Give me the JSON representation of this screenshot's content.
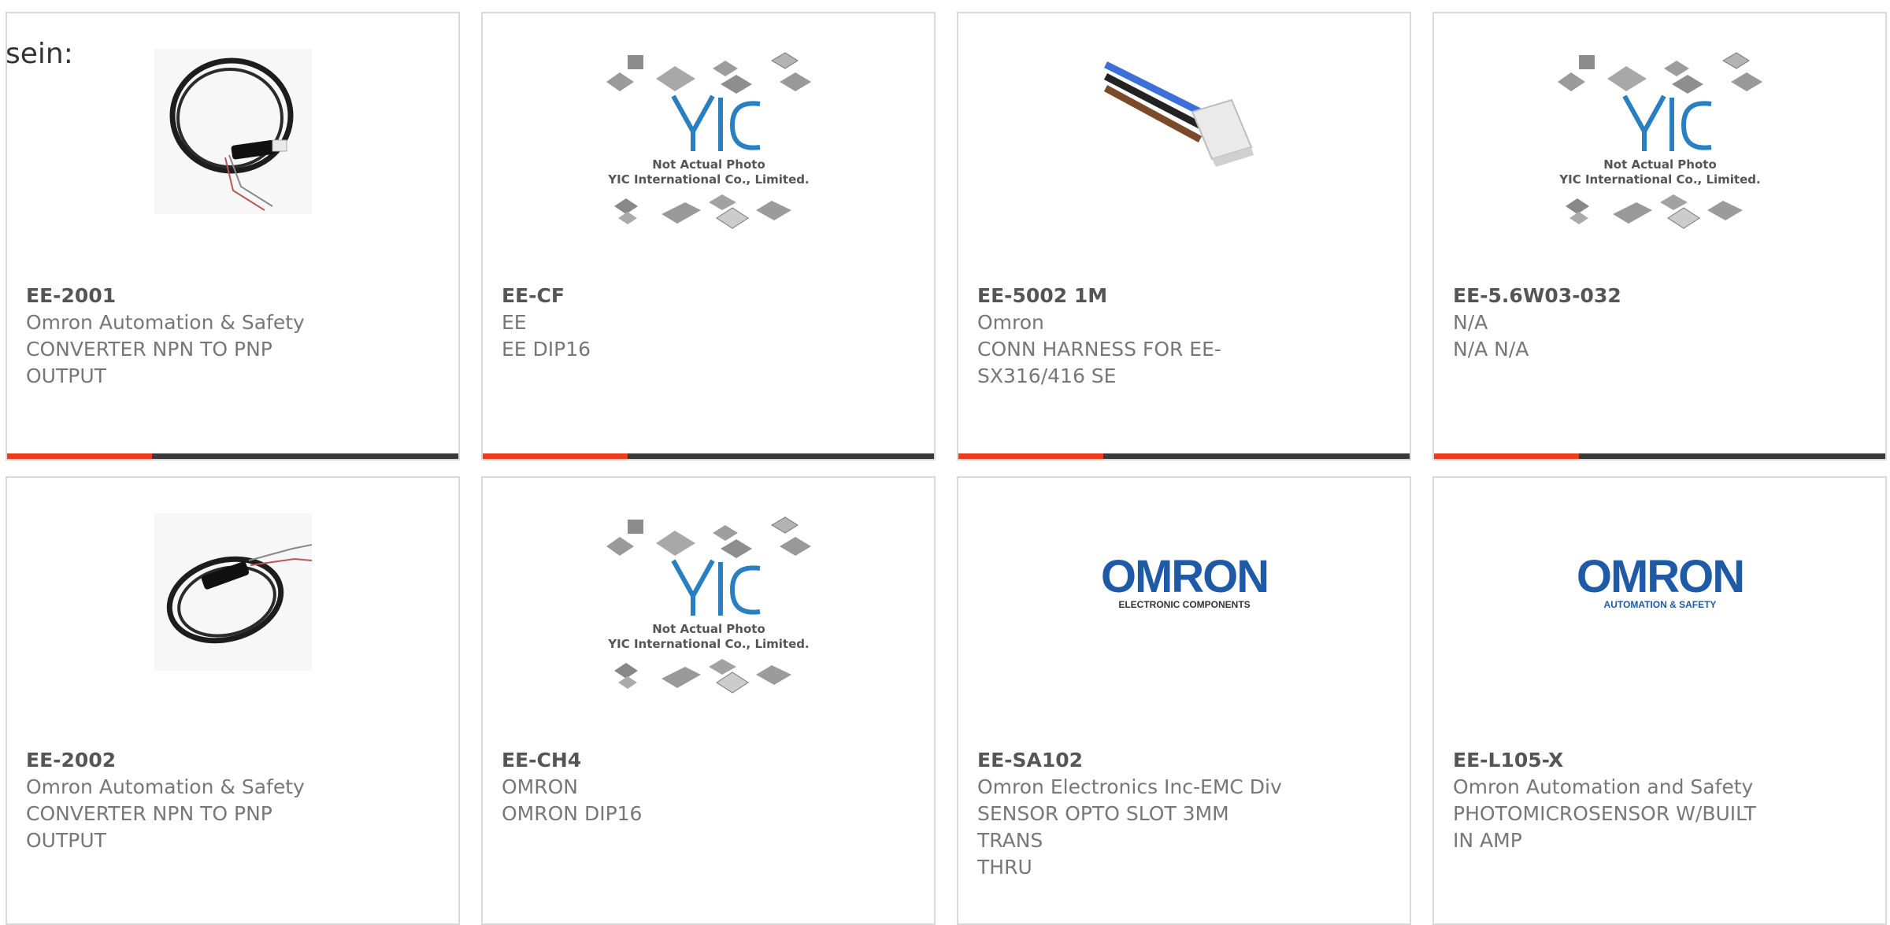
{
  "lead_text": "sein:",
  "brand": {
    "accent": "#e8401c",
    "bar": "#3a3a3a",
    "yic_blue": "#2a7fc1",
    "omron_blue": "#1f5aa6"
  },
  "placeholder": {
    "line1": "Not Actual Photo",
    "line2": "YIC International Co., Limited."
  },
  "logos": {
    "omron": "OMRON",
    "omron_ec": "ELECTRONIC COMPONENTS",
    "omron_as": "AUTOMATION & SAFETY"
  },
  "products": [
    {
      "part": "EE-2001",
      "mfr": "Omron Automation & Safety",
      "desc1": "CONVERTER NPN TO PNP",
      "desc2": "OUTPUT",
      "image": "cable-coil-photo"
    },
    {
      "part": "EE-CF",
      "mfr": "EE",
      "desc1": "EE DIP16",
      "desc2": "",
      "image": "yic-placeholder"
    },
    {
      "part": "EE-5002 1M",
      "mfr": "Omron",
      "desc1": "CONN HARNESS FOR EE-",
      "desc2": "SX316/416 SE",
      "image": "wire-harness-photo"
    },
    {
      "part": "EE-5.6W03-032",
      "mfr": "N/A",
      "desc1": "N/A N/A",
      "desc2": "",
      "image": "yic-placeholder"
    },
    {
      "part": "EE-2002",
      "mfr": "Omron Automation & Safety",
      "desc1": "CONVERTER NPN TO PNP",
      "desc2": "OUTPUT",
      "image": "cable-coil-photo"
    },
    {
      "part": "EE-CH4",
      "mfr": "OMRON",
      "desc1": "OMRON DIP16",
      "desc2": "",
      "image": "yic-placeholder"
    },
    {
      "part": "EE-SA102",
      "mfr": "Omron Electronics Inc-EMC Div",
      "desc1": "SENSOR OPTO SLOT 3MM TRANS",
      "desc2": "THRU",
      "image": "omron-ec-logo"
    },
    {
      "part": "EE-L105-X",
      "mfr": "Omron Automation and Safety",
      "desc1": "PHOTOMICROSENSOR W/BUILT",
      "desc2": "IN AMP",
      "image": "omron-as-logo"
    }
  ]
}
